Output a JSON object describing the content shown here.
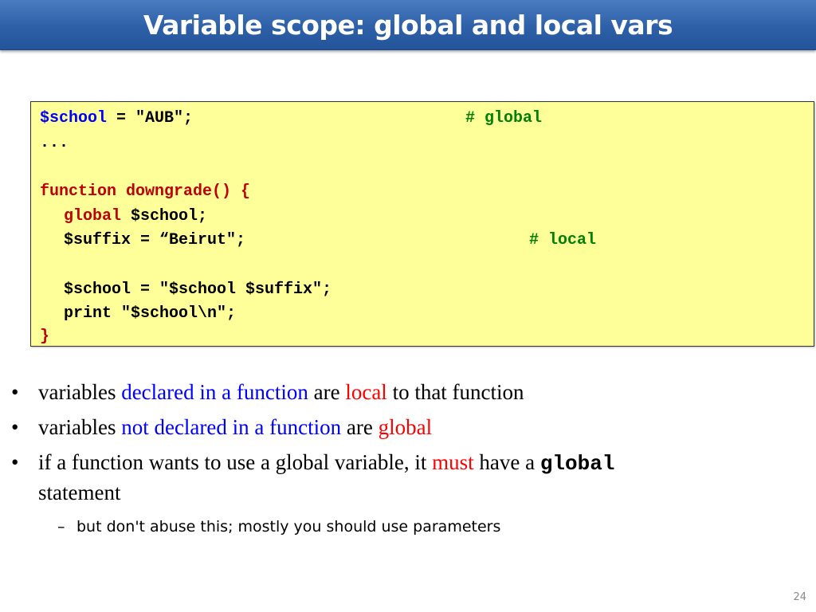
{
  "title": "Variable scope: global and local vars",
  "colors": {
    "title_bar": "#2d60a8",
    "code_background": "#ffff99",
    "code_variable": "#0000ff",
    "code_keyword": "#c00000",
    "code_comment": "#008000",
    "highlight_blue": "#0000ff",
    "highlight_red": "#ff0000"
  },
  "code": {
    "line1": {
      "var": "$school",
      "rest": " = \"AUB\";",
      "comment": "# global"
    },
    "line2": "...",
    "line3": {
      "keyword": "function downgrade() {"
    },
    "line4": {
      "keyword": "global",
      "rest": " $school;"
    },
    "line5": {
      "text": "$suffix = “Beirut\";",
      "comment": "# local"
    },
    "line6": "$school = \"$school $suffix\";",
    "line7": "print \"$school\\n\";",
    "line8": "}"
  },
  "bullets": {
    "marker": "•",
    "b1": {
      "t1": "variables ",
      "t2": "declared in a function",
      "t3": " are ",
      "t4": "local",
      "t5": " to that function"
    },
    "b2": {
      "t1": "variables ",
      "t2": "not declared in a function",
      "t3": " are ",
      "t4": "global"
    },
    "b3": {
      "t1": "if a function wants to use a global variable, it ",
      "t2": "must",
      "t3": " have a ",
      "t4": "global",
      "t5": "statement"
    },
    "sub": {
      "marker": "–",
      "text": "but don't abuse this; mostly you should use parameters"
    }
  },
  "page_number": "24"
}
